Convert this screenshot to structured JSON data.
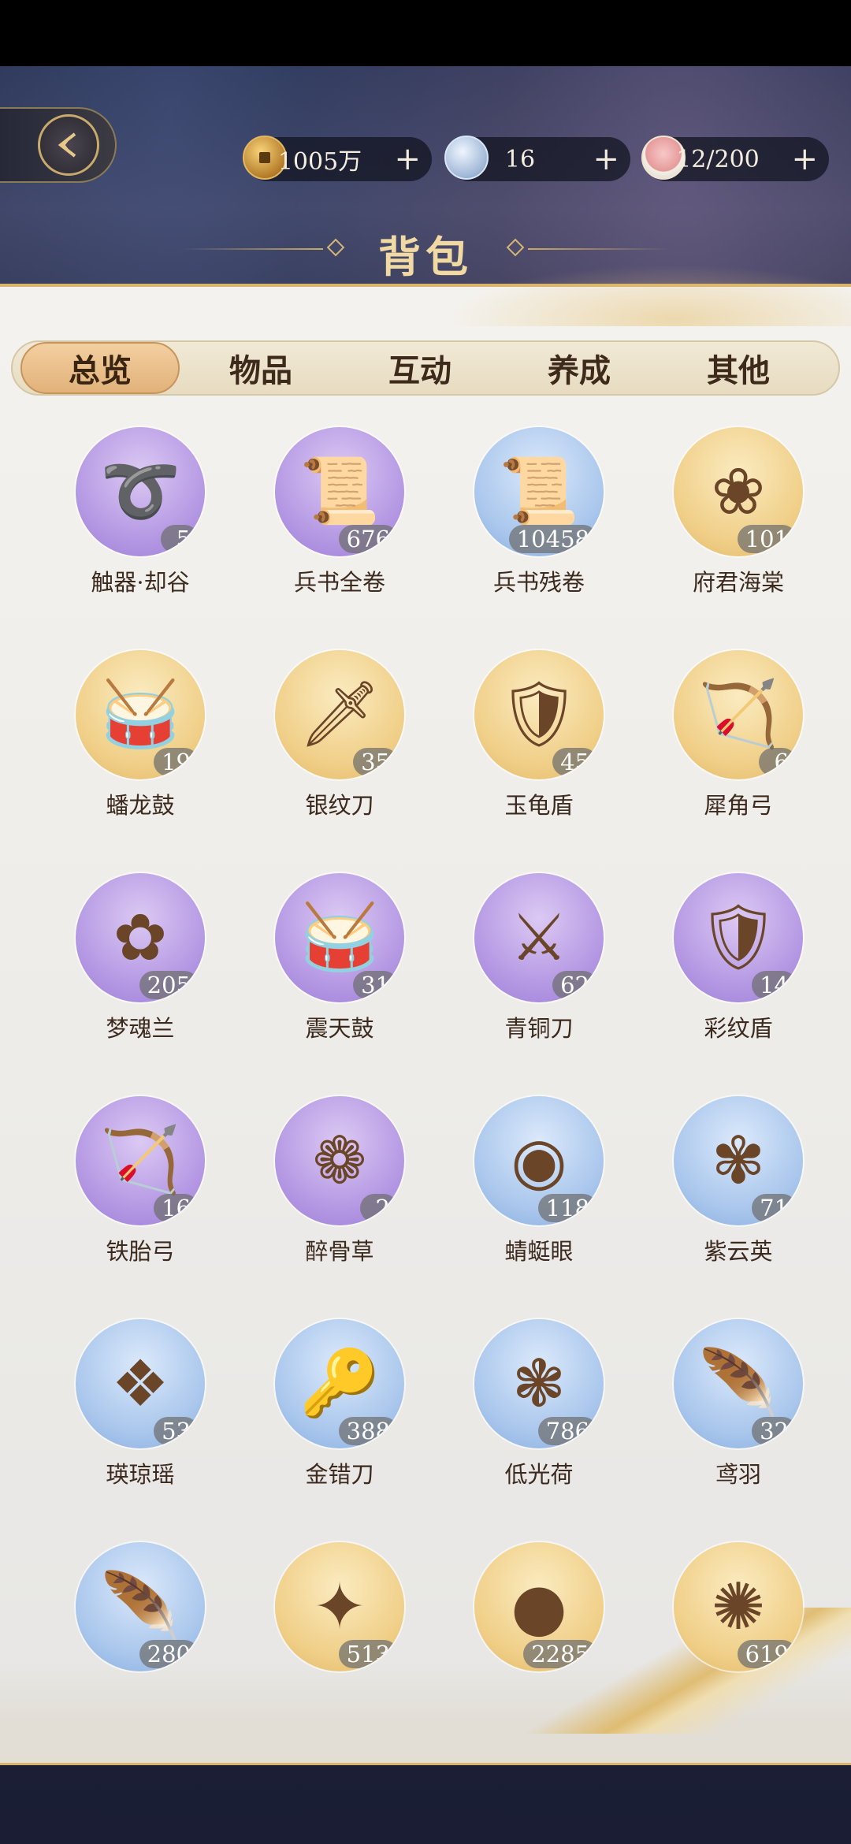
{
  "header": {
    "title": "背包",
    "back_icon": "back-arrow-icon",
    "currencies": [
      {
        "icon": "copper-coin-icon",
        "value": "1005万",
        "plus": "+"
      },
      {
        "icon": "jade-orb-icon",
        "value": "16",
        "plus": "+"
      },
      {
        "icon": "food-bowl-icon",
        "value": "12/200",
        "plus": "+"
      }
    ]
  },
  "tabs": [
    {
      "label": "总览",
      "active": true
    },
    {
      "label": "物品",
      "active": false
    },
    {
      "label": "互动",
      "active": false
    },
    {
      "label": "养成",
      "active": false
    },
    {
      "label": "其他",
      "active": false
    }
  ],
  "items": [
    {
      "name": "触器·却谷",
      "count": "5",
      "bg": "purple",
      "icon": "rope-icon",
      "glyph": "➰"
    },
    {
      "name": "兵书全卷",
      "count": "676",
      "bg": "purple",
      "icon": "scroll-icon",
      "glyph": "📜"
    },
    {
      "name": "兵书残卷",
      "count": "10458",
      "bg": "blue",
      "icon": "scroll-icon",
      "glyph": "📜"
    },
    {
      "name": "府君海棠",
      "count": "101",
      "bg": "gold",
      "icon": "flower-branch-icon",
      "glyph": "❀"
    },
    {
      "name": "蟠龙鼓",
      "count": "19",
      "bg": "gold",
      "icon": "drum-icon",
      "glyph": "🥁"
    },
    {
      "name": "银纹刀",
      "count": "35",
      "bg": "gold",
      "icon": "knife-icon",
      "glyph": "🗡"
    },
    {
      "name": "玉龟盾",
      "count": "45",
      "bg": "gold",
      "icon": "shield-icon",
      "glyph": "🛡"
    },
    {
      "name": "犀角弓",
      "count": "6",
      "bg": "gold",
      "icon": "bow-icon",
      "glyph": "🏹"
    },
    {
      "name": "梦魂兰",
      "count": "205",
      "bg": "purple",
      "icon": "orchid-icon",
      "glyph": "✿"
    },
    {
      "name": "震天鼓",
      "count": "31",
      "bg": "purple",
      "icon": "bronze-drum-icon",
      "glyph": "🥁"
    },
    {
      "name": "青铜刀",
      "count": "62",
      "bg": "purple",
      "icon": "bronze-blade-icon",
      "glyph": "⚔"
    },
    {
      "name": "彩纹盾",
      "count": "14",
      "bg": "purple",
      "icon": "patterned-shield-icon",
      "glyph": "🛡"
    },
    {
      "name": "铁胎弓",
      "count": "16",
      "bg": "purple",
      "icon": "bow-icon",
      "glyph": "🏹"
    },
    {
      "name": "醉骨草",
      "count": "2",
      "bg": "purple",
      "icon": "herb-icon",
      "glyph": "❁"
    },
    {
      "name": "蜻蜓眼",
      "count": "118",
      "bg": "blue",
      "icon": "bead-icon",
      "glyph": "◉"
    },
    {
      "name": "紫云英",
      "count": "71",
      "bg": "blue",
      "icon": "clover-flower-icon",
      "glyph": "✾"
    },
    {
      "name": "瑛琼瑶",
      "count": "53",
      "bg": "blue",
      "icon": "jade-pendant-icon",
      "glyph": "❖"
    },
    {
      "name": "金错刀",
      "count": "388",
      "bg": "blue",
      "icon": "coin-knife-icon",
      "glyph": "🔑"
    },
    {
      "name": "低光荷",
      "count": "786",
      "bg": "blue",
      "icon": "lotus-icon",
      "glyph": "❃"
    },
    {
      "name": "鸢羽",
      "count": "32",
      "bg": "blue",
      "icon": "feather-icon",
      "glyph": "🪶"
    },
    {
      "name": "",
      "count": "280",
      "bg": "blue",
      "icon": "white-feather-icon",
      "glyph": "🪶"
    },
    {
      "name": "",
      "count": "513",
      "bg": "gold",
      "icon": "star-mirror-icon",
      "glyph": "✦"
    },
    {
      "name": "",
      "count": "2285",
      "bg": "gold",
      "icon": "water-orb-icon",
      "glyph": "●"
    },
    {
      "name": "",
      "count": "619",
      "bg": "gold",
      "icon": "amber-ornament-icon",
      "glyph": "✺"
    }
  ]
}
